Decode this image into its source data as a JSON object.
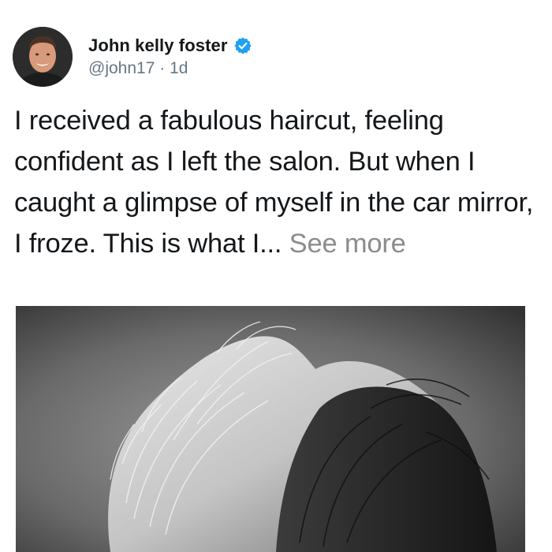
{
  "post": {
    "author": {
      "display_name": "John kelly foster",
      "handle": "@john17",
      "separator": "·",
      "time_ago": "1d",
      "verified": true
    },
    "text": "I received a fabulous haircut, feeling confident as I left the salon. But when I caught a glimpse of myself in the car mirror, I froze. This is what I...",
    "see_more_label": "See more"
  },
  "icons": {
    "verified": "verified-badge-icon"
  },
  "colors": {
    "verified_blue": "#1da1f2",
    "text_primary": "#14171a",
    "text_secondary": "#657786",
    "see_more": "#8c8c8c"
  }
}
